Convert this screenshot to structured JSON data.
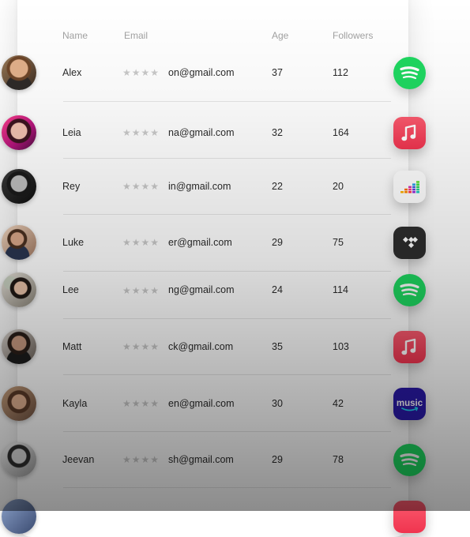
{
  "header": {
    "name": "Name",
    "email": "Email",
    "age": "Age",
    "followers": "Followers"
  },
  "rows": [
    {
      "name": "Alex",
      "email": "on@gmail.com",
      "age": "37",
      "followers": "112",
      "stars": "★★★★",
      "app": "spotify-icon"
    },
    {
      "name": "Leia",
      "email": "na@gmail.com",
      "age": "32",
      "followers": "164",
      "stars": "★★★★",
      "app": "apple-music-icon"
    },
    {
      "name": "Rey",
      "email": "in@gmail.com",
      "age": "22",
      "followers": "20",
      "stars": "★★★★",
      "app": "deezer-icon"
    },
    {
      "name": "Luke",
      "email": "er@gmail.com",
      "age": "29",
      "followers": "75",
      "stars": "★★★★",
      "app": "tidal-icon"
    },
    {
      "name": "Lee",
      "email": "ng@gmail.com",
      "age": "24",
      "followers": "114",
      "stars": "★★★★",
      "app": "spotify-icon"
    },
    {
      "name": "Matt",
      "email": "ck@gmail.com",
      "age": "35",
      "followers": "103",
      "stars": "★★★★",
      "app": "apple-music-icon"
    },
    {
      "name": "Kayla",
      "email": "en@gmail.com",
      "age": "30",
      "followers": "42",
      "stars": "★★★★",
      "app": "amazon-music-icon"
    },
    {
      "name": "Jeevan",
      "email": "sh@gmail.com",
      "age": "29",
      "followers": "78",
      "stars": "★★★★",
      "app": "spotify-icon"
    }
  ],
  "brand_colors": {
    "spotify": "#1ed760",
    "apple_music": "#f3445b",
    "tidal": "#2d2d2d",
    "amazon_music": "#2a1aa8"
  },
  "amazon_label": "music"
}
